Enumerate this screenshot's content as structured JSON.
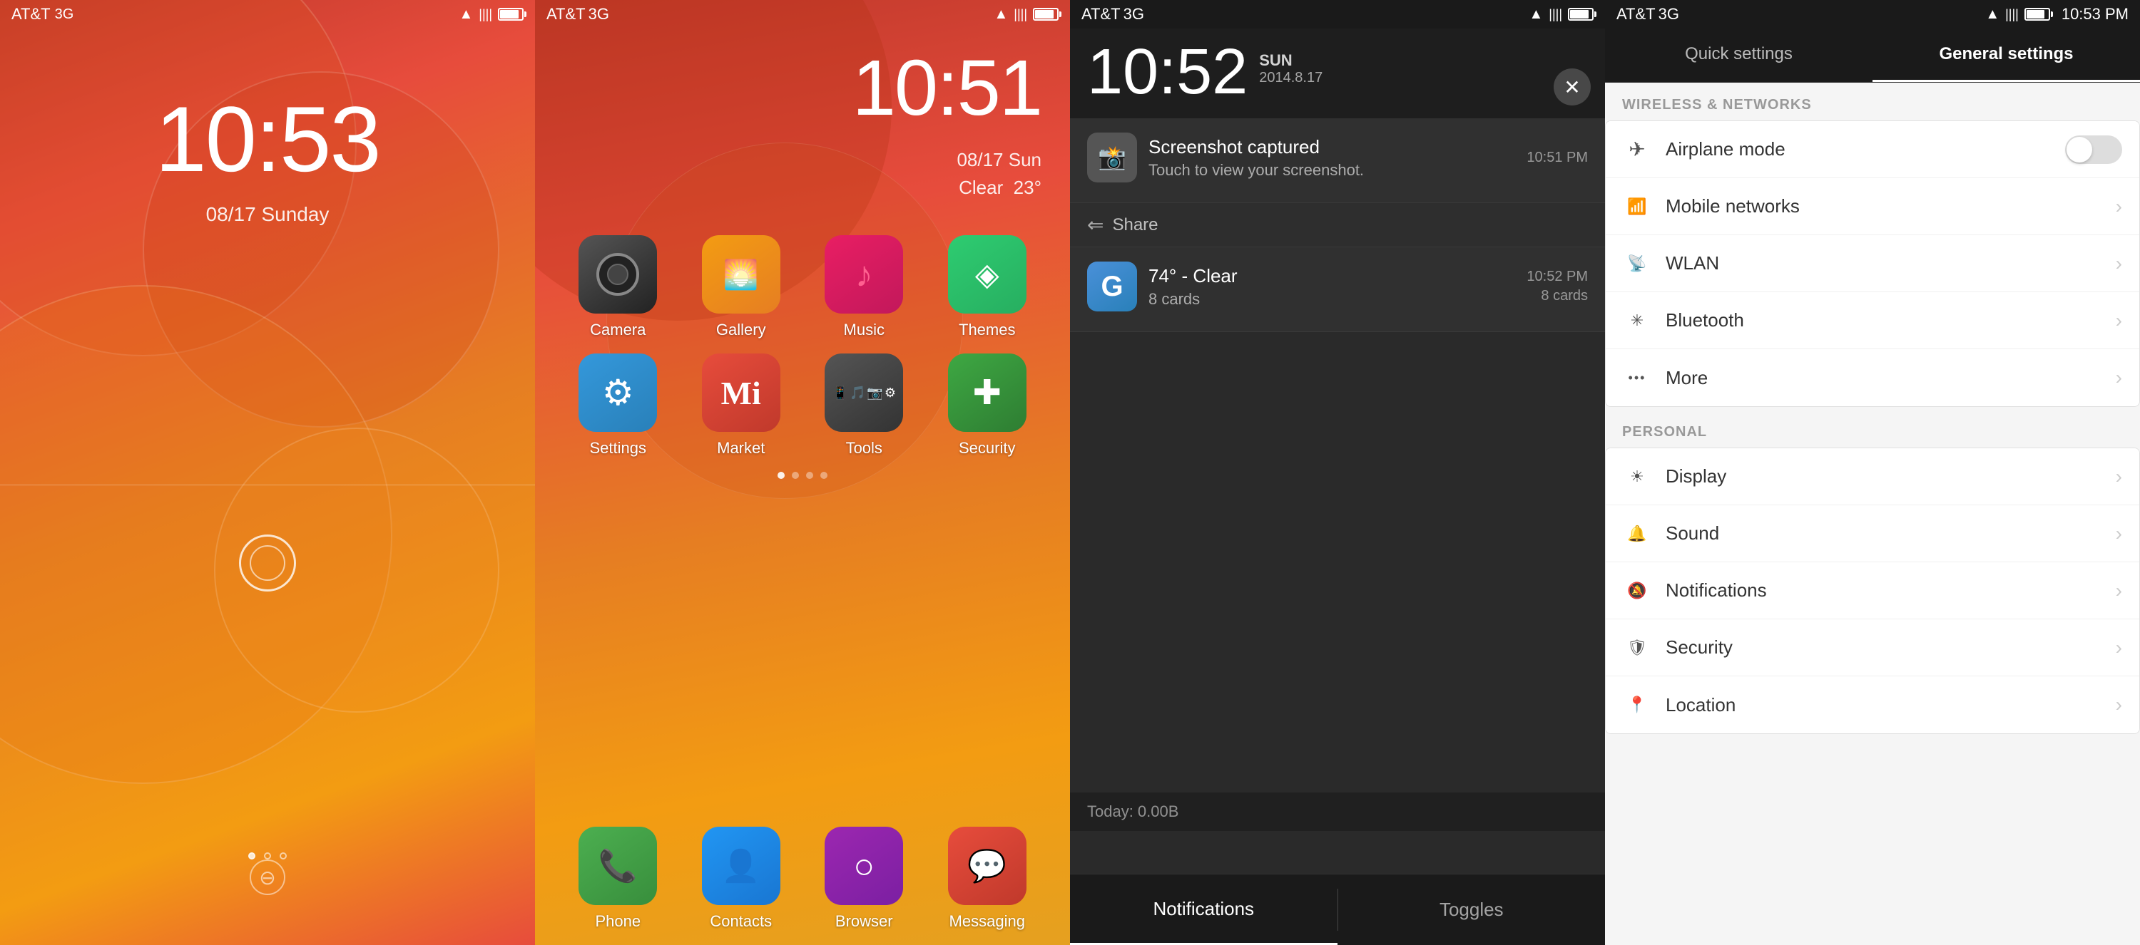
{
  "screens": {
    "lockscreen": {
      "carrier": "AT&T",
      "network": "3G",
      "time": "10:53",
      "date": "08/17 Sunday",
      "statusIcons": [
        "wifi",
        "signal",
        "battery"
      ]
    },
    "homescreen": {
      "carrier": "AT&T",
      "network": "3G",
      "time": "10:51",
      "dateWeather": "08/17 Sun\nClear  23°",
      "apps": [
        {
          "name": "Camera",
          "icon": "📷",
          "iconClass": "icon-camera"
        },
        {
          "name": "Gallery",
          "icon": "🖼",
          "iconClass": "icon-gallery"
        },
        {
          "name": "Music",
          "icon": "♪",
          "iconClass": "icon-music"
        },
        {
          "name": "Themes",
          "icon": "🎨",
          "iconClass": "icon-themes"
        },
        {
          "name": "Settings",
          "icon": "⚙",
          "iconClass": "icon-settings"
        },
        {
          "name": "Market",
          "icon": "M",
          "iconClass": "icon-market"
        },
        {
          "name": "Tools",
          "icon": "🔧",
          "iconClass": "icon-tools"
        },
        {
          "name": "Security",
          "icon": "🛡",
          "iconClass": "icon-security"
        }
      ],
      "dockApps": [
        {
          "name": "Phone",
          "icon": "📞",
          "iconClass": "icon-phone"
        },
        {
          "name": "Contacts",
          "icon": "👤",
          "iconClass": "icon-contacts"
        },
        {
          "name": "Browser",
          "icon": "○",
          "iconClass": "icon-browser"
        },
        {
          "name": "Messaging",
          "icon": "💬",
          "iconClass": "icon-messaging"
        }
      ]
    },
    "notifications": {
      "carrier": "AT&T",
      "network": "3G",
      "time": "10:52",
      "weekday": "SUN",
      "date": "2014.8.17",
      "notifications": [
        {
          "title": "Screenshot captured",
          "subtitle": "Touch to view your screenshot.",
          "time": "10:51 PM",
          "icon": "📷"
        },
        {
          "title": "74° - Clear",
          "subtitle": "8 cards",
          "time": "10:52 PM",
          "icon": "G"
        }
      ],
      "shareLabel": "Share",
      "trafficLabel": "Today: 0.00B",
      "tab1": "Notifications",
      "tab2": "Toggles"
    },
    "settings": {
      "carrier": "AT&T",
      "network": "3G",
      "time": "10:53 PM",
      "tab1": "Quick settings",
      "tab2": "General settings",
      "section1": "WIRELESS & NETWORKS",
      "section2": "PERSONAL",
      "items": [
        {
          "label": "Airplane mode",
          "icon": "✈",
          "type": "toggle"
        },
        {
          "label": "Mobile networks",
          "icon": "📶",
          "type": "chevron"
        },
        {
          "label": "WLAN",
          "icon": "📡",
          "type": "chevron"
        },
        {
          "label": "Bluetooth",
          "icon": "⚡",
          "type": "chevron"
        },
        {
          "label": "More",
          "icon": "···",
          "type": "chevron"
        },
        {
          "label": "Display",
          "icon": "☀",
          "type": "chevron"
        },
        {
          "label": "Sound",
          "icon": "🔔",
          "type": "chevron"
        },
        {
          "label": "Notifications",
          "icon": "🔔",
          "type": "chevron"
        },
        {
          "label": "Security",
          "icon": "🛡",
          "type": "chevron"
        },
        {
          "label": "Location",
          "icon": "📍",
          "type": "chevron"
        }
      ]
    }
  }
}
